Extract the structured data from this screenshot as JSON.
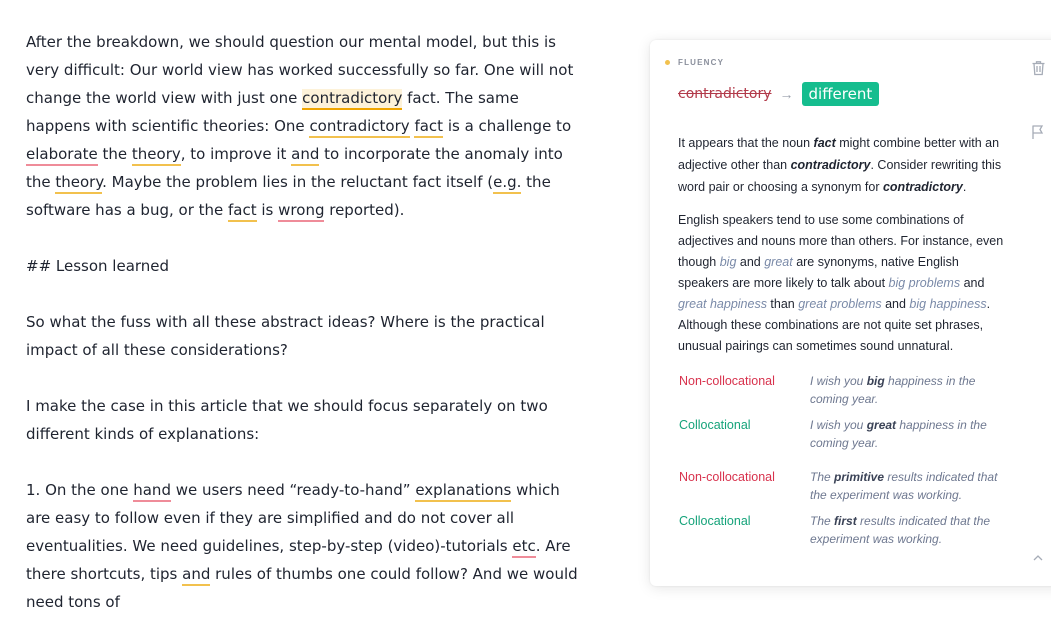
{
  "editor": {
    "p1": {
      "t1": "After the breakdown, we should question our mental model, but this is very difficult: Our world view has worked successfully so far. One will not change the world view with just one ",
      "w1": "contradictory",
      "t2": " fact. The same happens with scientific theories: One ",
      "w2": "contradictory",
      "t3": " ",
      "w3": "fact",
      "t4": " is a challenge to ",
      "w4": "elaborate",
      "t5": " the ",
      "w5": "theory",
      "t6": ", to improve it ",
      "w6": "and",
      "t7": " to incorporate the anomaly into the ",
      "w7": "theory",
      "t8": ". Maybe the problem lies in the reluctant fact itself (",
      "w8": "e.g.",
      "t9": " the software has a bug, or the ",
      "w9": "fact",
      "t10": " is ",
      "w10": "wrong",
      "t11": " reported)."
    },
    "p2": "## Lesson learned",
    "p3": "So what the fuss with all these abstract ideas? Where is the practical impact of all these considerations?",
    "p4": "I make the case in this article that we should focus separately on two different kinds of explanations:",
    "p5": {
      "t1": "1. On the one ",
      "w1": "hand",
      "t2": " we users need “ready-to-hand” ",
      "w2": "explanations",
      "t3": " which are easy to follow even if they are simplified and do not cover all eventualities. We need guidelines, step-by-step (video)-tutorials ",
      "w3": "etc",
      "t4": ". Are there shortcuts, tips ",
      "w4": "and",
      "t5": " rules of thumbs one could follow? And we would need tons of"
    }
  },
  "card": {
    "category": "FLUENCY",
    "original": "contradictory",
    "arrow": "→",
    "replacement": "different",
    "expl1": {
      "a": "It appears that the noun ",
      "b": "fact",
      "c": " might combine better with an adjective other than ",
      "d": "contradictory",
      "e": ". Consider rewriting this word pair or choosing a synonym for ",
      "f": "contradictory",
      "g": "."
    },
    "expl2": {
      "a": "English speakers tend to use some combinations of adjectives and nouns more than others. For instance, even though ",
      "b": "big",
      "c": " and ",
      "d": "great",
      "e": " are synonyms, native English speakers are more likely to talk about ",
      "f": "big problems",
      "g": " and ",
      "h": "great happiness",
      "i": " than ",
      "j": "great problems",
      "k": " and ",
      "l": "big happiness",
      "m": ". Although these combinations are not quite set phrases, unusual pairings can sometimes sound unnatural."
    },
    "examples": [
      {
        "type": "Non-collocational",
        "pre": "I wish you ",
        "bold": "big",
        "post": " happiness in the coming year."
      },
      {
        "type": "Collocational",
        "pre": "I wish you ",
        "bold": "great",
        "post": " happiness in the coming year."
      },
      {
        "type": "Non-collocational",
        "pre": "The ",
        "bold": "primitive",
        "post": " results indicated that the experiment was working."
      },
      {
        "type": "Collocational",
        "pre": "The ",
        "bold": "first",
        "post": " results indicated that the experiment was working."
      }
    ],
    "icons": {
      "delete": "trash-icon",
      "flag": "flag-icon",
      "collapse": "chevron-up-icon"
    },
    "colors": {
      "accent": "#15bd8e",
      "bad": "#d8324d",
      "good": "#15a37a",
      "fluency": "#f2c14e"
    }
  }
}
